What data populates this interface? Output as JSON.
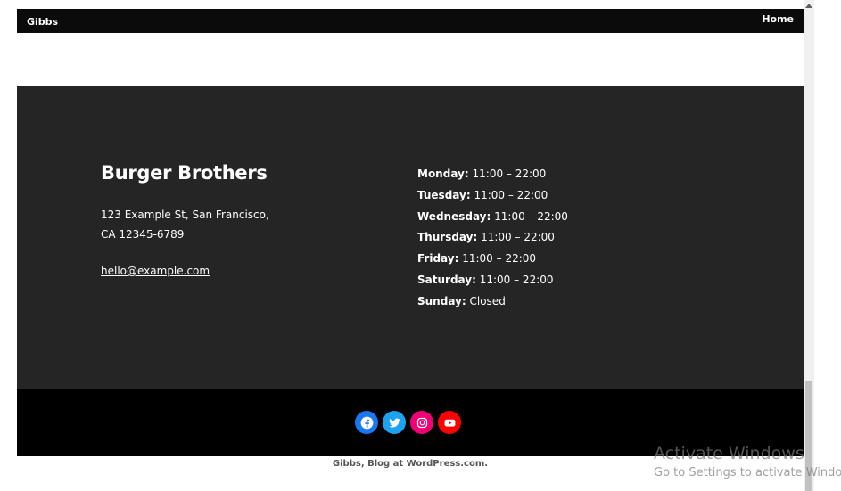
{
  "header": {
    "site_title": "Gibbs",
    "nav_home": "Home"
  },
  "footer": {
    "business_name": "Burger Brothers",
    "address_line1": "123 Example St, San Francisco,",
    "address_line2": "CA 12345-6789",
    "email": "hello@example.com",
    "hours": [
      {
        "day": "Monday:",
        "time": "11:00 – 22:00"
      },
      {
        "day": "Tuesday:",
        "time": "11:00 – 22:00"
      },
      {
        "day": "Wednesday:",
        "time": "11:00 – 22:00"
      },
      {
        "day": "Thursday:",
        "time": "11:00 – 22:00"
      },
      {
        "day": "Friday:",
        "time": "11:00 – 22:00"
      },
      {
        "day": "Saturday:",
        "time": "11:00 – 22:00"
      },
      {
        "day": "Sunday:",
        "time": "Closed"
      }
    ]
  },
  "social": {
    "icons": [
      {
        "name": "facebook-icon",
        "color": "#1877f2"
      },
      {
        "name": "twitter-icon",
        "color": "#1da1f2"
      },
      {
        "name": "instagram-icon",
        "color": "#f00075"
      },
      {
        "name": "youtube-icon",
        "color": "#ff0000"
      }
    ]
  },
  "credit": "Gibbs, Blog at WordPress.com.",
  "watermark": {
    "title": "Activate Windows",
    "subtitle": "Go to Settings to activate Windows."
  }
}
